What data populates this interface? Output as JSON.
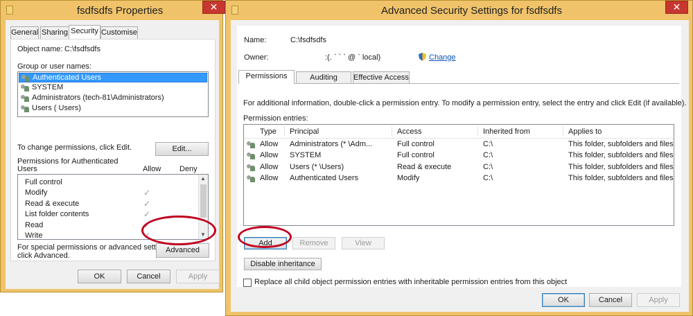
{
  "properties_window": {
    "title": "fsdfsdfs Properties",
    "close_label": "✕",
    "tabs": [
      {
        "label": "General"
      },
      {
        "label": "Sharing"
      },
      {
        "label": "Security"
      },
      {
        "label": "Customise"
      }
    ],
    "object_name_label": "Object name:",
    "object_name_value": "C:\\fsdfsdfs",
    "group_label": "Group or user names:",
    "users": [
      {
        "label": "Authenticated Users"
      },
      {
        "label": "SYSTEM"
      },
      {
        "label": "Administrators (tech-81\\Administrators)"
      },
      {
        "label": "Users (            Users)"
      }
    ],
    "change_text": "To change permissions, click Edit.",
    "edit_label": "Edit...",
    "perm_header_line1": "Permissions for Authenticated",
    "perm_header_line2": "Users",
    "allow_label": "Allow",
    "deny_label": "Deny",
    "permissions": [
      {
        "label": "Full control"
      },
      {
        "label": "Modify"
      },
      {
        "label": "Read & execute"
      },
      {
        "label": "List folder contents"
      },
      {
        "label": "Read"
      },
      {
        "label": "Write"
      }
    ],
    "check_glyph": "✓",
    "special_text_line1": "For special permissions or advanced settings,",
    "special_text_line2": "click Advanced.",
    "advanced_label": "Advanced",
    "ok_label": "OK",
    "cancel_label": "Cancel",
    "apply_label": "Apply"
  },
  "advanced_window": {
    "title": "Advanced Security Settings for fsdfsdfs",
    "close_label": "✕",
    "name_label": "Name:",
    "name_value": "C:\\fsdfsdfs",
    "owner_label": "Owner:",
    "owner_value": ":(.        ` ` ` @ `            local)",
    "change_label": "Change",
    "tabs": [
      {
        "label": "Permissions"
      },
      {
        "label": "Auditing"
      },
      {
        "label": "Effective Access"
      }
    ],
    "info_text": "For additional information, double-click a permission entry. To modify a permission entry, select the entry and click Edit (if available).",
    "entries_label": "Permission entries:",
    "columns": [
      "Type",
      "Principal",
      "Access",
      "Inherited from",
      "Applies to"
    ],
    "rows": [
      {
        "type": "Allow",
        "principal": "Administrators (*          \\Adm...",
        "access": "Full control",
        "inherited": "C:\\",
        "applies": "This folder, subfolders and files"
      },
      {
        "type": "Allow",
        "principal": "SYSTEM",
        "access": "Full control",
        "inherited": "C:\\",
        "applies": "This folder, subfolders and files"
      },
      {
        "type": "Allow",
        "principal": "Users (*          \\Users)",
        "access": "Read & execute",
        "inherited": "C:\\",
        "applies": "This folder, subfolders and files"
      },
      {
        "type": "Allow",
        "principal": "Authenticated Users",
        "access": "Modify",
        "inherited": "C:\\",
        "applies": "This folder, subfolders and files"
      }
    ],
    "add_label": "Add",
    "remove_label": "Remove",
    "view_label": "View",
    "disable_label": "Disable inheritance",
    "replace_label": "Replace all child object permission entries with inheritable permission entries from this object",
    "ok_label": "OK",
    "cancel_label": "Cancel",
    "apply_label": "Apply"
  }
}
